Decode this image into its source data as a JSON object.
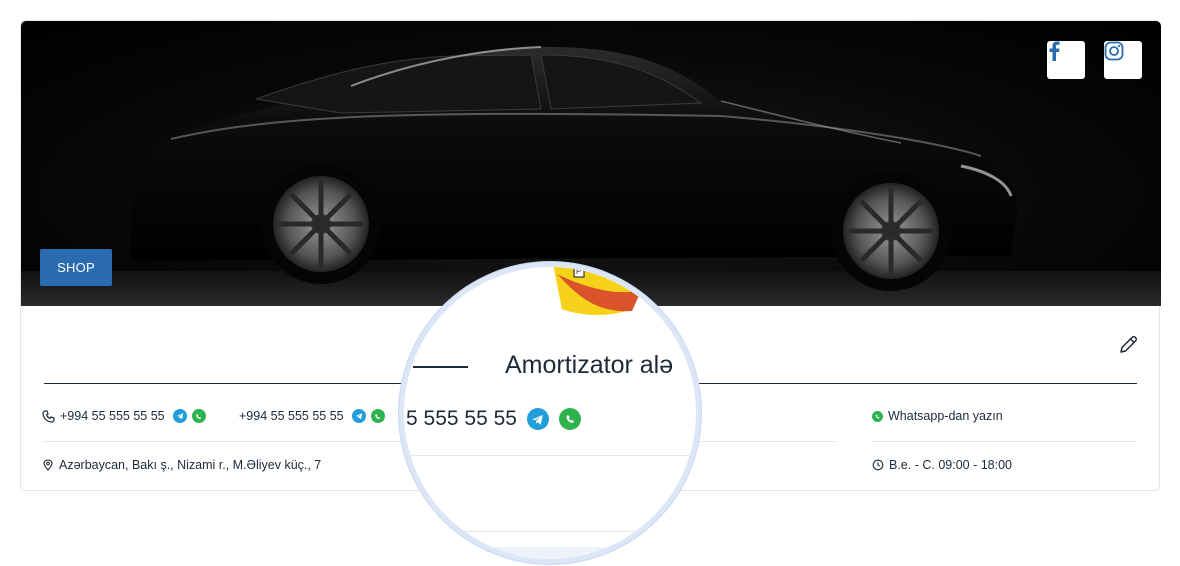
{
  "banner": {
    "shop_label": "SHOP"
  },
  "social": {
    "facebook_icon": "facebook-icon",
    "instagram_icon": "instagram-icon"
  },
  "company": {
    "name": "Amortizator alə"
  },
  "contacts": {
    "phone1": "+994 55 555 55 55",
    "phone2": "+994 55 555 55 55",
    "phone_zoomed": "5 555 55 55",
    "whatsapp_label": "Whatsapp-dan yazın",
    "address": "Azərbaycan, Bakı ş., Nizami r., M.Əliyev küç., 7",
    "hours": "B.e. - C. 09:00 - 18:00"
  },
  "colors": {
    "primary": "#2b6cb0",
    "telegram": "#229ed9",
    "whatsapp": "#2eb24d",
    "facebook": "#1877f2"
  }
}
